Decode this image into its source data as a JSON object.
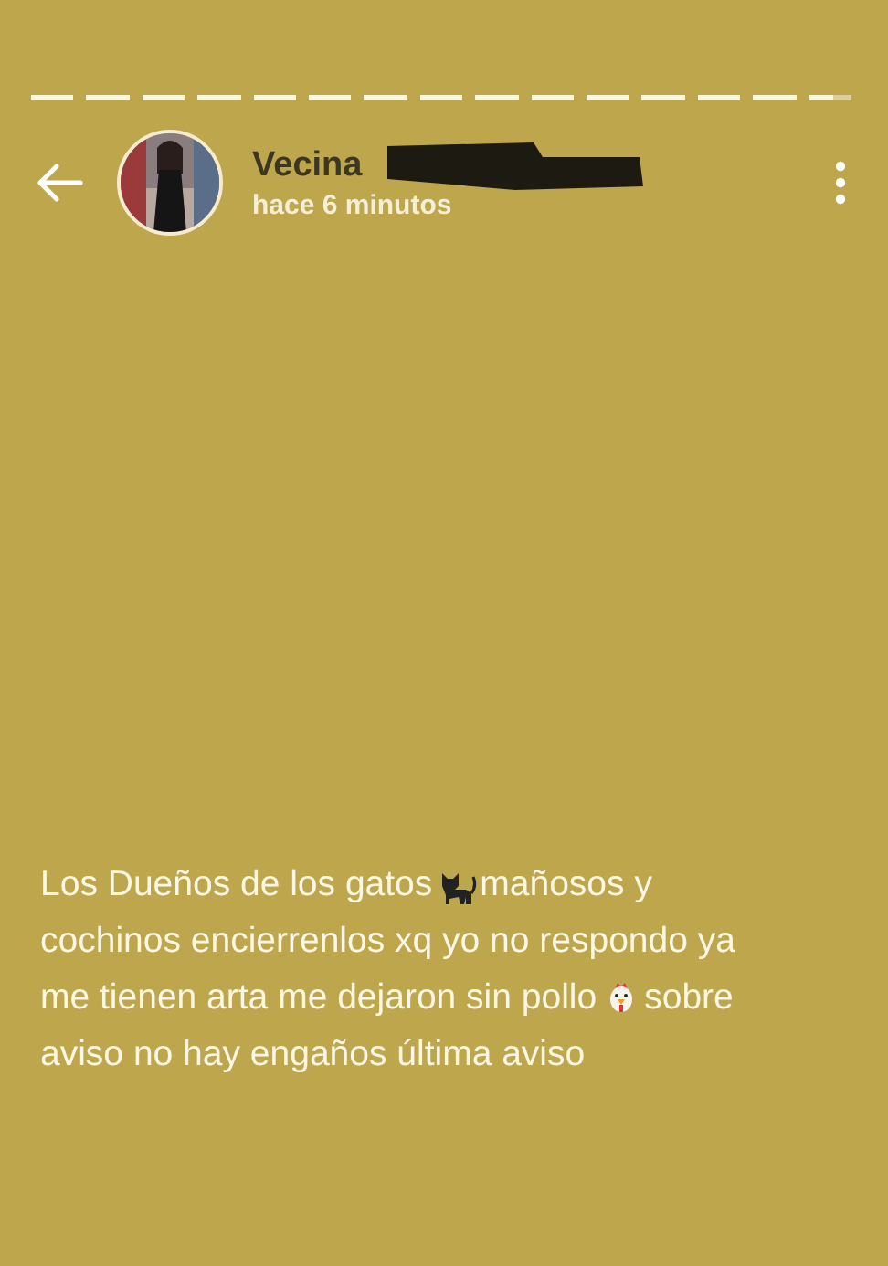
{
  "progress": [
    {
      "level": 1
    },
    {
      "level": 1
    },
    {
      "level": 1
    },
    {
      "level": 1
    },
    {
      "level": 1
    },
    {
      "level": 1
    },
    {
      "level": 1
    },
    {
      "level": 1
    },
    {
      "level": 1
    },
    {
      "level": 1
    },
    {
      "level": 1
    },
    {
      "level": 1
    },
    {
      "level": 1
    },
    {
      "level": 1
    },
    {
      "level": 0.55
    }
  ],
  "header": {
    "name": "Vecina",
    "time": "hace 6 minutos"
  },
  "status": [
    [
      {
        "kind": "text",
        "text": "Los Dueños de los gatos"
      },
      {
        "kind": "cat"
      },
      {
        "kind": "text",
        "text": "mañosos y"
      }
    ],
    [
      {
        "kind": "text",
        "text": "cochinos encierrenlos xq yo no respondo ya"
      }
    ],
    [
      {
        "kind": "text",
        "text": "me tienen arta me dejaron sin pollo"
      },
      {
        "kind": "chicken"
      },
      {
        "kind": "text",
        "text": "sobre"
      }
    ],
    [
      {
        "kind": "text",
        "text": "aviso no hay engaños última aviso"
      }
    ]
  ]
}
